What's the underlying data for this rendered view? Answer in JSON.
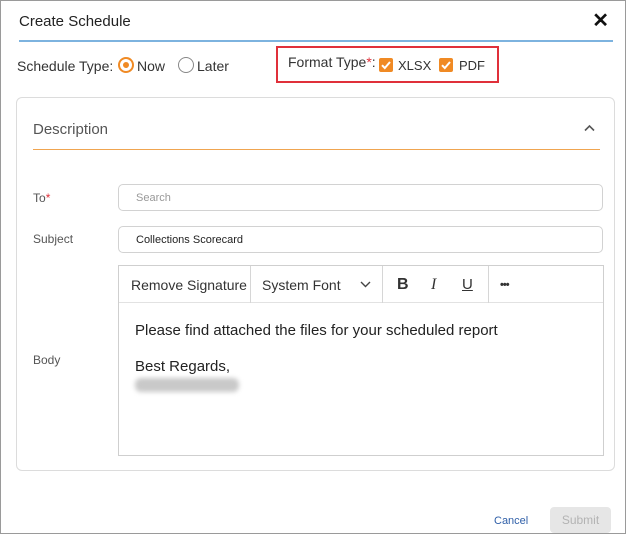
{
  "dialog": {
    "title": "Create Schedule",
    "close_glyph": "✕"
  },
  "schedule_type": {
    "label": "Schedule Type:",
    "options": [
      {
        "label": "Now",
        "selected": true
      },
      {
        "label": "Later",
        "selected": false
      }
    ]
  },
  "format_type": {
    "label": "Format Type",
    "required_mark": "*",
    "suffix": ":",
    "options": [
      {
        "label": "XLSX",
        "checked": true
      },
      {
        "label": "PDF",
        "checked": true
      }
    ],
    "highlight_color": "#e0303a"
  },
  "description": {
    "title": "Description",
    "collapse_icon": "chevron-up-icon",
    "to": {
      "label": "To",
      "required_mark": "*",
      "placeholder": "Search",
      "value": ""
    },
    "subject": {
      "label": "Subject",
      "value": "Collections Scorecard"
    },
    "body": {
      "label": "Body",
      "toolbar": {
        "remove_signature": "Remove Signature",
        "font": "System Font",
        "bold": "B",
        "italic": "I",
        "underline": "U",
        "more": "•••"
      },
      "text": "Please find attached the files for your scheduled report",
      "closing": "Best Regards,"
    }
  },
  "footer": {
    "cancel": "Cancel",
    "submit": "Submit"
  },
  "colors": {
    "accent": "#f08a24",
    "title_underline": "#7db3df",
    "link": "#2f5fa8"
  }
}
